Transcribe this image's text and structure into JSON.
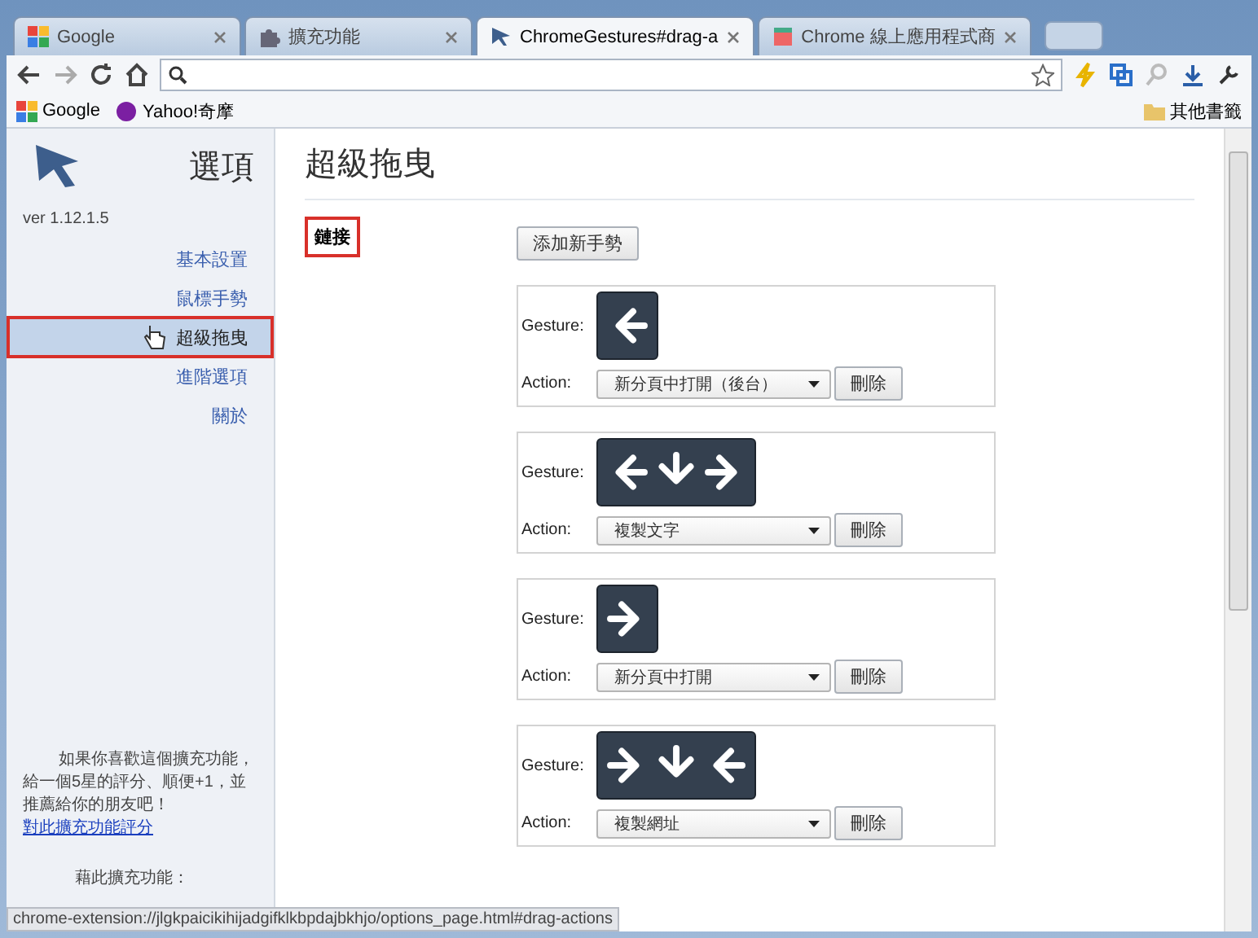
{
  "tabs": [
    {
      "label": "Google",
      "selected": false
    },
    {
      "label": "擴充功能",
      "selected": false
    },
    {
      "label": "ChromeGestures#drag-a",
      "selected": true
    },
    {
      "label": "Chrome 線上應用程式商",
      "selected": false
    }
  ],
  "bookmarks": [
    {
      "label": "Google"
    },
    {
      "label": "Yahoo!奇摩"
    }
  ],
  "other_bookmarks": "其他書籤",
  "sidebar": {
    "title": "選項",
    "version": "ver 1.12.1.5",
    "items": [
      {
        "label": "基本設置",
        "selected": false
      },
      {
        "label": "鼠標手勢",
        "selected": false
      },
      {
        "label": "超級拖曳",
        "selected": true
      },
      {
        "label": "進階選項",
        "selected": false
      },
      {
        "label": "關於",
        "selected": false
      }
    ],
    "promo": "如果你喜歡這個擴充功能，給一個5星的評分、順便+1，並推薦給你的朋友吧！",
    "promo_link": "對此擴充功能評分",
    "note": "藉此擴充功能："
  },
  "page": {
    "title": "超級拖曳",
    "section": {
      "label": "鏈接",
      "highlighted": true
    },
    "add_button": "添加新手勢",
    "gestures": [
      {
        "gesture_label": "Gesture:",
        "arrows": [
          {
            "kind": "left"
          }
        ],
        "action_label": "Action:",
        "action": "新分頁中打開（後台）",
        "delete": "刪除"
      },
      {
        "gesture_label": "Gesture:",
        "arrows": [
          {
            "kind": "left"
          },
          {
            "kind": "down"
          },
          {
            "kind": "right"
          }
        ],
        "action_label": "Action:",
        "action": "複製文字",
        "delete": "刪除"
      },
      {
        "gesture_label": "Gesture:",
        "arrows": [
          {
            "kind": "right"
          }
        ],
        "action_label": "Action:",
        "action": "新分頁中打開",
        "delete": "刪除"
      },
      {
        "gesture_label": "Gesture:",
        "arrows": [
          {
            "kind": "right"
          },
          {
            "kind": "down"
          },
          {
            "kind": "left"
          }
        ],
        "action_label": "Action:",
        "action": "複製網址",
        "delete": "刪除"
      }
    ]
  },
  "status_bar": "chrome-extension://jlgkpaicikihijadgifklkbpdajbkhjo/options_page.html#drag-actions"
}
